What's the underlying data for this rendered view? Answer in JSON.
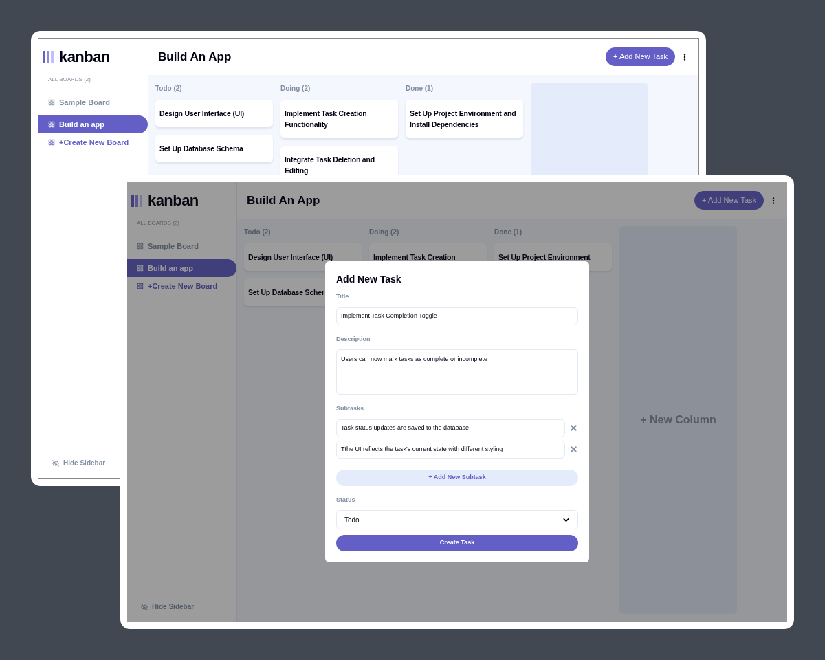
{
  "screens": [
    {
      "dimmed": false,
      "logo": "kanban",
      "boards_label": "ALL BOARDS (2)",
      "boards": [
        {
          "name": "Sample Board",
          "selected": false
        },
        {
          "name": "Build an app",
          "selected": true
        }
      ],
      "create_board": "+Create New Board",
      "hide_sidebar": "Hide Sidebar",
      "title": "Build An App",
      "add_task": "+ Add New Task",
      "columns": [
        {
          "name": "Todo (2)",
          "tasks": [
            "Design User Interface (UI)",
            "Set Up Database Schema"
          ]
        },
        {
          "name": "Doing (2)",
          "tasks": [
            "Implement Task Creation Functionality",
            "Integrate Task Deletion and Editing"
          ]
        },
        {
          "name": "Done (1)",
          "tasks": [
            "Set Up Project Environment and Install Dependencies"
          ]
        }
      ]
    },
    {
      "dimmed": true,
      "logo": "kanban",
      "boards_label": "ALL BOARDS (2)",
      "boards": [
        {
          "name": "Sample Board",
          "selected": false
        },
        {
          "name": "Build an app",
          "selected": true
        }
      ],
      "create_board": "+Create New Board",
      "hide_sidebar": "Hide Sidebar",
      "title": "Build An App",
      "add_task": "+ Add New Task",
      "columns": [
        {
          "name": "Todo (2)",
          "tasks": [
            "Design User Interface (UI)",
            "Set Up Database Scher"
          ]
        },
        {
          "name": "Doing (2)",
          "tasks": [
            "Implement Task Creation"
          ]
        },
        {
          "name": "Done (1)",
          "tasks": [
            "Set Up Project Environment"
          ]
        }
      ],
      "new_column": "+ New Column",
      "modal": {
        "title": "Add New Task",
        "title_label": "Title",
        "title_value": "Implement Task Completion Toggle",
        "description_label": "Description",
        "description_value": "Users can now mark tasks as complete or incomplete",
        "subtasks_label": "Subtasks",
        "subtasks": [
          "Task status updates are saved to the database",
          "Tthe UI reflects the task's current state with different styling"
        ],
        "add_subtask": "+ Add New Subtask",
        "status_label": "Status",
        "status_value": "Todo",
        "submit": "Create Task"
      }
    }
  ]
}
